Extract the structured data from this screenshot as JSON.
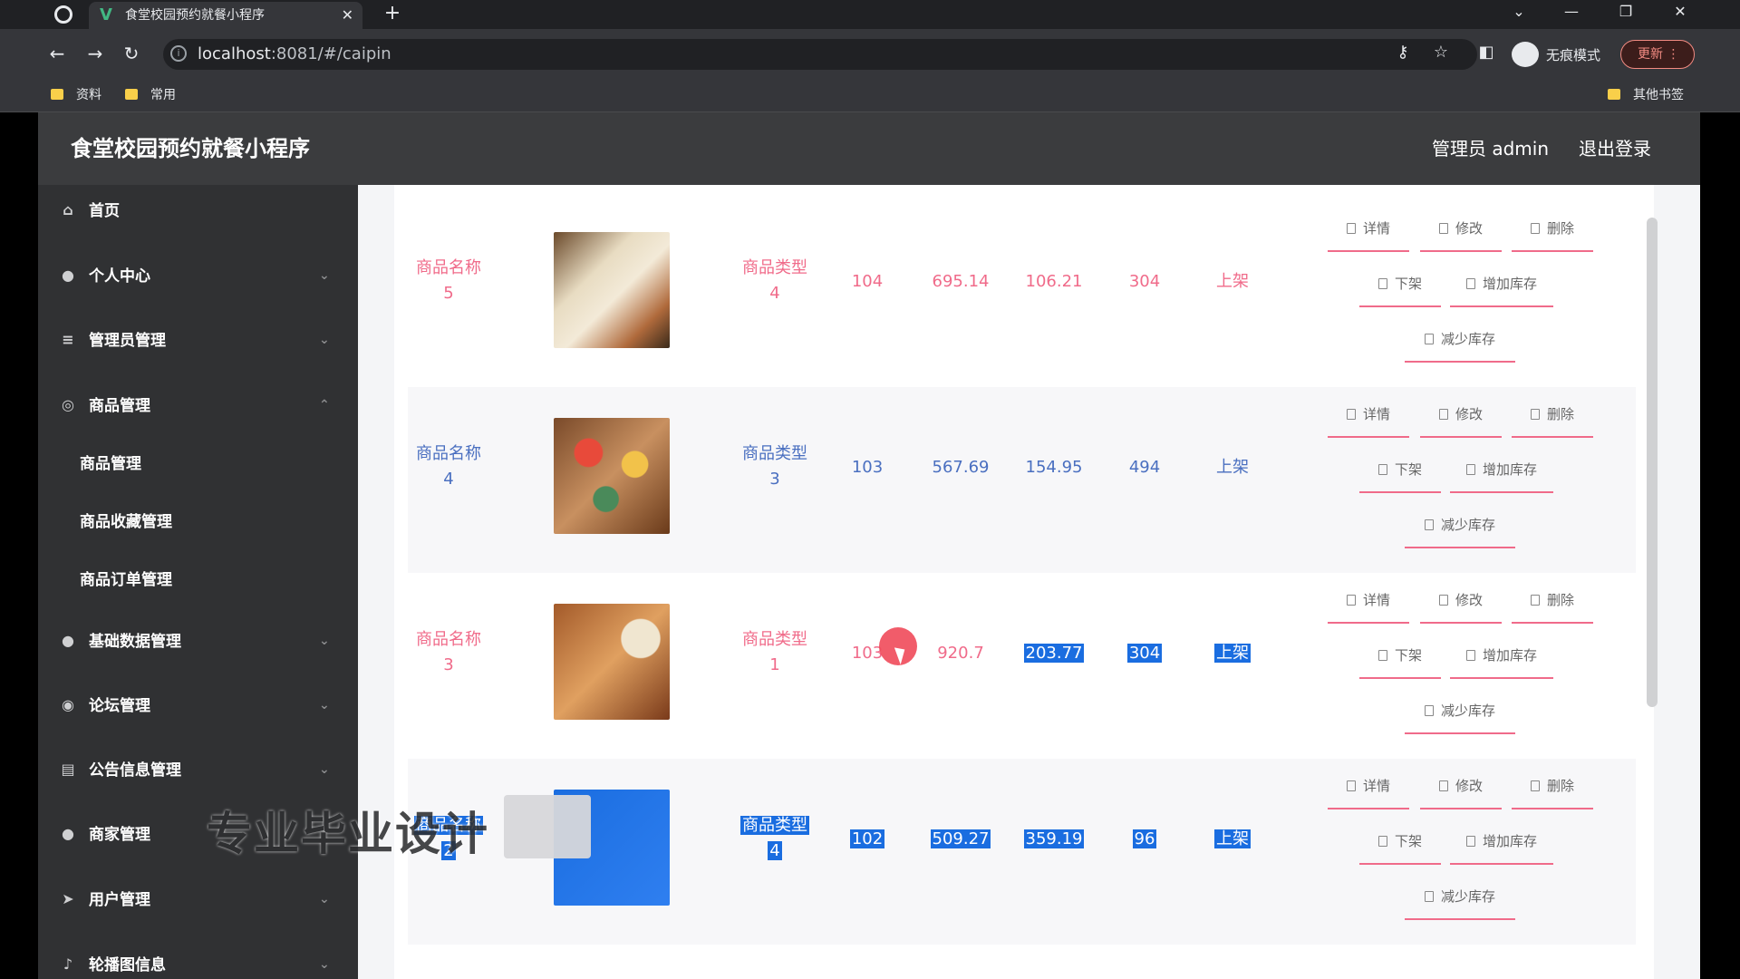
{
  "browser": {
    "tab_title": "食堂校园预约就餐小程序",
    "tab_close": "✕",
    "new_tab": "+",
    "url_host": "localhost",
    "url_rest": ":8081/#/caipin",
    "incognito_label": "无痕模式",
    "update_label": "更新",
    "bookmarks": [
      "资料",
      "常用"
    ],
    "other_bookmarks": "其他书签"
  },
  "app": {
    "title": "食堂校园预约就餐小程序",
    "admin_label": "管理员 admin",
    "logout_label": "退出登录"
  },
  "sidebar": {
    "items": [
      {
        "label": "首页",
        "icon": "home-icon"
      },
      {
        "label": "个人中心",
        "icon": "user-icon"
      },
      {
        "label": "管理员管理",
        "icon": "list-icon"
      },
      {
        "label": "商品管理",
        "icon": "compass-icon"
      },
      {
        "label": "基础数据管理",
        "icon": "user-icon"
      },
      {
        "label": "论坛管理",
        "icon": "target-icon"
      },
      {
        "label": "公告信息管理",
        "icon": "doc-icon"
      },
      {
        "label": "商家管理",
        "icon": "user-icon"
      },
      {
        "label": "用户管理",
        "icon": "send-icon"
      },
      {
        "label": "轮播图信息",
        "icon": "mic-icon"
      }
    ],
    "subitems": [
      "商品管理",
      "商品收藏管理",
      "商品订单管理"
    ]
  },
  "table": {
    "rows": [
      {
        "name": [
          "商品名称",
          "5"
        ],
        "type": [
          "商品类型",
          "4"
        ],
        "v1": "104",
        "v2": "695.14",
        "v3": "106.21",
        "v4": "304",
        "status": "上架",
        "color": "#f06b8a"
      },
      {
        "name": [
          "商品名称",
          "4"
        ],
        "type": [
          "商品类型",
          "3"
        ],
        "v1": "103",
        "v2": "567.69",
        "v3": "154.95",
        "v4": "494",
        "status": "上架",
        "color": "#4a6fc0"
      },
      {
        "name": [
          "商品名称",
          "3"
        ],
        "type": [
          "商品类型",
          "1"
        ],
        "v1": "103",
        "v2": "920.7",
        "v3": "203.77",
        "v4": "304",
        "status": "上架",
        "color": "#f06b8a"
      },
      {
        "name": [
          "商品名称",
          "2"
        ],
        "type": [
          "商品类型",
          "4"
        ],
        "v1": "102",
        "v2": "509.27",
        "v3": "359.19",
        "v4": "96",
        "status": "上架",
        "color": "#4a6fc0"
      }
    ],
    "actions": {
      "detail": "详情",
      "edit": "修改",
      "delete": "删除",
      "off_shelf": "下架",
      "add_stock": "增加库存",
      "reduce_stock": "减少库存"
    }
  },
  "watermark": "专业毕业设计"
}
